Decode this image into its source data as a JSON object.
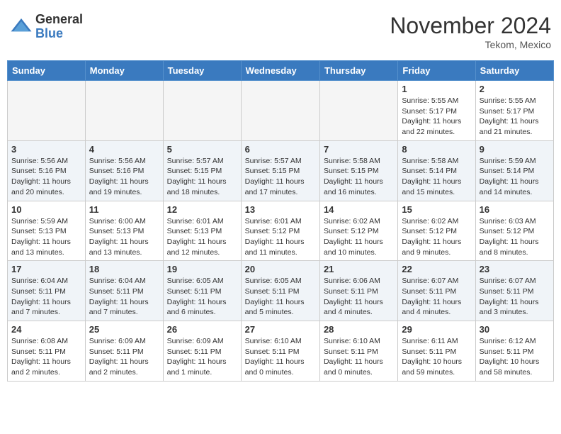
{
  "header": {
    "logo_general": "General",
    "logo_blue": "Blue",
    "month_title": "November 2024",
    "location": "Tekom, Mexico"
  },
  "days_of_week": [
    "Sunday",
    "Monday",
    "Tuesday",
    "Wednesday",
    "Thursday",
    "Friday",
    "Saturday"
  ],
  "weeks": [
    {
      "days": [
        {
          "number": "",
          "empty": true
        },
        {
          "number": "",
          "empty": true
        },
        {
          "number": "",
          "empty": true
        },
        {
          "number": "",
          "empty": true
        },
        {
          "number": "",
          "empty": true
        },
        {
          "number": "1",
          "sunrise": "Sunrise: 5:55 AM",
          "sunset": "Sunset: 5:17 PM",
          "daylight": "Daylight: 11 hours and 22 minutes."
        },
        {
          "number": "2",
          "sunrise": "Sunrise: 5:55 AM",
          "sunset": "Sunset: 5:17 PM",
          "daylight": "Daylight: 11 hours and 21 minutes."
        }
      ]
    },
    {
      "days": [
        {
          "number": "3",
          "sunrise": "Sunrise: 5:56 AM",
          "sunset": "Sunset: 5:16 PM",
          "daylight": "Daylight: 11 hours and 20 minutes."
        },
        {
          "number": "4",
          "sunrise": "Sunrise: 5:56 AM",
          "sunset": "Sunset: 5:16 PM",
          "daylight": "Daylight: 11 hours and 19 minutes."
        },
        {
          "number": "5",
          "sunrise": "Sunrise: 5:57 AM",
          "sunset": "Sunset: 5:15 PM",
          "daylight": "Daylight: 11 hours and 18 minutes."
        },
        {
          "number": "6",
          "sunrise": "Sunrise: 5:57 AM",
          "sunset": "Sunset: 5:15 PM",
          "daylight": "Daylight: 11 hours and 17 minutes."
        },
        {
          "number": "7",
          "sunrise": "Sunrise: 5:58 AM",
          "sunset": "Sunset: 5:15 PM",
          "daylight": "Daylight: 11 hours and 16 minutes."
        },
        {
          "number": "8",
          "sunrise": "Sunrise: 5:58 AM",
          "sunset": "Sunset: 5:14 PM",
          "daylight": "Daylight: 11 hours and 15 minutes."
        },
        {
          "number": "9",
          "sunrise": "Sunrise: 5:59 AM",
          "sunset": "Sunset: 5:14 PM",
          "daylight": "Daylight: 11 hours and 14 minutes."
        }
      ]
    },
    {
      "days": [
        {
          "number": "10",
          "sunrise": "Sunrise: 5:59 AM",
          "sunset": "Sunset: 5:13 PM",
          "daylight": "Daylight: 11 hours and 13 minutes."
        },
        {
          "number": "11",
          "sunrise": "Sunrise: 6:00 AM",
          "sunset": "Sunset: 5:13 PM",
          "daylight": "Daylight: 11 hours and 13 minutes."
        },
        {
          "number": "12",
          "sunrise": "Sunrise: 6:01 AM",
          "sunset": "Sunset: 5:13 PM",
          "daylight": "Daylight: 11 hours and 12 minutes."
        },
        {
          "number": "13",
          "sunrise": "Sunrise: 6:01 AM",
          "sunset": "Sunset: 5:12 PM",
          "daylight": "Daylight: 11 hours and 11 minutes."
        },
        {
          "number": "14",
          "sunrise": "Sunrise: 6:02 AM",
          "sunset": "Sunset: 5:12 PM",
          "daylight": "Daylight: 11 hours and 10 minutes."
        },
        {
          "number": "15",
          "sunrise": "Sunrise: 6:02 AM",
          "sunset": "Sunset: 5:12 PM",
          "daylight": "Daylight: 11 hours and 9 minutes."
        },
        {
          "number": "16",
          "sunrise": "Sunrise: 6:03 AM",
          "sunset": "Sunset: 5:12 PM",
          "daylight": "Daylight: 11 hours and 8 minutes."
        }
      ]
    },
    {
      "days": [
        {
          "number": "17",
          "sunrise": "Sunrise: 6:04 AM",
          "sunset": "Sunset: 5:11 PM",
          "daylight": "Daylight: 11 hours and 7 minutes."
        },
        {
          "number": "18",
          "sunrise": "Sunrise: 6:04 AM",
          "sunset": "Sunset: 5:11 PM",
          "daylight": "Daylight: 11 hours and 7 minutes."
        },
        {
          "number": "19",
          "sunrise": "Sunrise: 6:05 AM",
          "sunset": "Sunset: 5:11 PM",
          "daylight": "Daylight: 11 hours and 6 minutes."
        },
        {
          "number": "20",
          "sunrise": "Sunrise: 6:05 AM",
          "sunset": "Sunset: 5:11 PM",
          "daylight": "Daylight: 11 hours and 5 minutes."
        },
        {
          "number": "21",
          "sunrise": "Sunrise: 6:06 AM",
          "sunset": "Sunset: 5:11 PM",
          "daylight": "Daylight: 11 hours and 4 minutes."
        },
        {
          "number": "22",
          "sunrise": "Sunrise: 6:07 AM",
          "sunset": "Sunset: 5:11 PM",
          "daylight": "Daylight: 11 hours and 4 minutes."
        },
        {
          "number": "23",
          "sunrise": "Sunrise: 6:07 AM",
          "sunset": "Sunset: 5:11 PM",
          "daylight": "Daylight: 11 hours and 3 minutes."
        }
      ]
    },
    {
      "days": [
        {
          "number": "24",
          "sunrise": "Sunrise: 6:08 AM",
          "sunset": "Sunset: 5:11 PM",
          "daylight": "Daylight: 11 hours and 2 minutes."
        },
        {
          "number": "25",
          "sunrise": "Sunrise: 6:09 AM",
          "sunset": "Sunset: 5:11 PM",
          "daylight": "Daylight: 11 hours and 2 minutes."
        },
        {
          "number": "26",
          "sunrise": "Sunrise: 6:09 AM",
          "sunset": "Sunset: 5:11 PM",
          "daylight": "Daylight: 11 hours and 1 minute."
        },
        {
          "number": "27",
          "sunrise": "Sunrise: 6:10 AM",
          "sunset": "Sunset: 5:11 PM",
          "daylight": "Daylight: 11 hours and 0 minutes."
        },
        {
          "number": "28",
          "sunrise": "Sunrise: 6:10 AM",
          "sunset": "Sunset: 5:11 PM",
          "daylight": "Daylight: 11 hours and 0 minutes."
        },
        {
          "number": "29",
          "sunrise": "Sunrise: 6:11 AM",
          "sunset": "Sunset: 5:11 PM",
          "daylight": "Daylight: 10 hours and 59 minutes."
        },
        {
          "number": "30",
          "sunrise": "Sunrise: 6:12 AM",
          "sunset": "Sunset: 5:11 PM",
          "daylight": "Daylight: 10 hours and 58 minutes."
        }
      ]
    }
  ]
}
